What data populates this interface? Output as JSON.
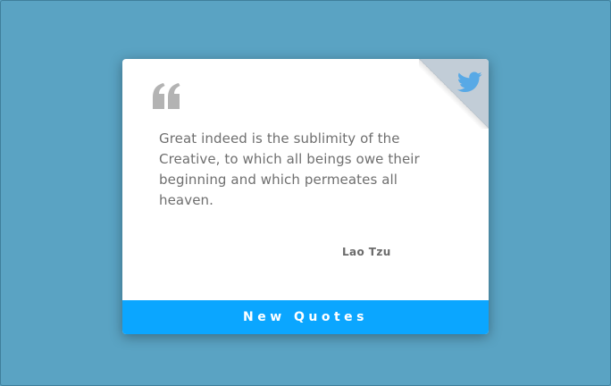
{
  "page": {
    "background_color": "#5aa3c3"
  },
  "card": {
    "background_color": "#ffffff",
    "quote_icon": "quote-mark-icon",
    "tweet_corner": {
      "icon": "twitter-icon",
      "color": "#58a9e6",
      "fold_color": "#c2cdd7"
    },
    "quote": "Great indeed is the sublimity of the Creative, to which all beings owe their beginning and which permeates all heaven.",
    "author": "Lao Tzu",
    "new_quote_button": {
      "label": "New Quotes",
      "color": "#0ba6ff"
    }
  }
}
